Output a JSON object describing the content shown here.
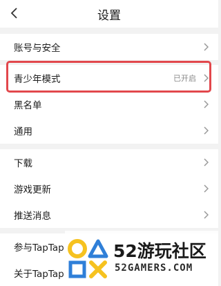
{
  "header": {
    "title": "设置"
  },
  "sections": [
    {
      "items": [
        {
          "label": "账号与安全"
        }
      ]
    },
    {
      "items": [
        {
          "label": "青少年模式",
          "value": "已开启"
        },
        {
          "label": "黑名单"
        },
        {
          "label": "通用"
        }
      ]
    },
    {
      "items": [
        {
          "label": "下载"
        },
        {
          "label": "游戏更新"
        },
        {
          "label": "推送消息"
        }
      ]
    },
    {
      "items": [
        {
          "label": "参与TapTap"
        },
        {
          "label": "关于TapTap"
        }
      ]
    }
  ],
  "watermark": {
    "name": "52游玩社区",
    "domain": "52GAMERS.COM"
  },
  "colors": {
    "highlight": "#e2474c",
    "logo_yellow": "#f6c21f",
    "logo_blue": "#2f7fd8"
  },
  "icons": {
    "back": "chevron-left-icon",
    "row": "chevron-right-icon"
  }
}
